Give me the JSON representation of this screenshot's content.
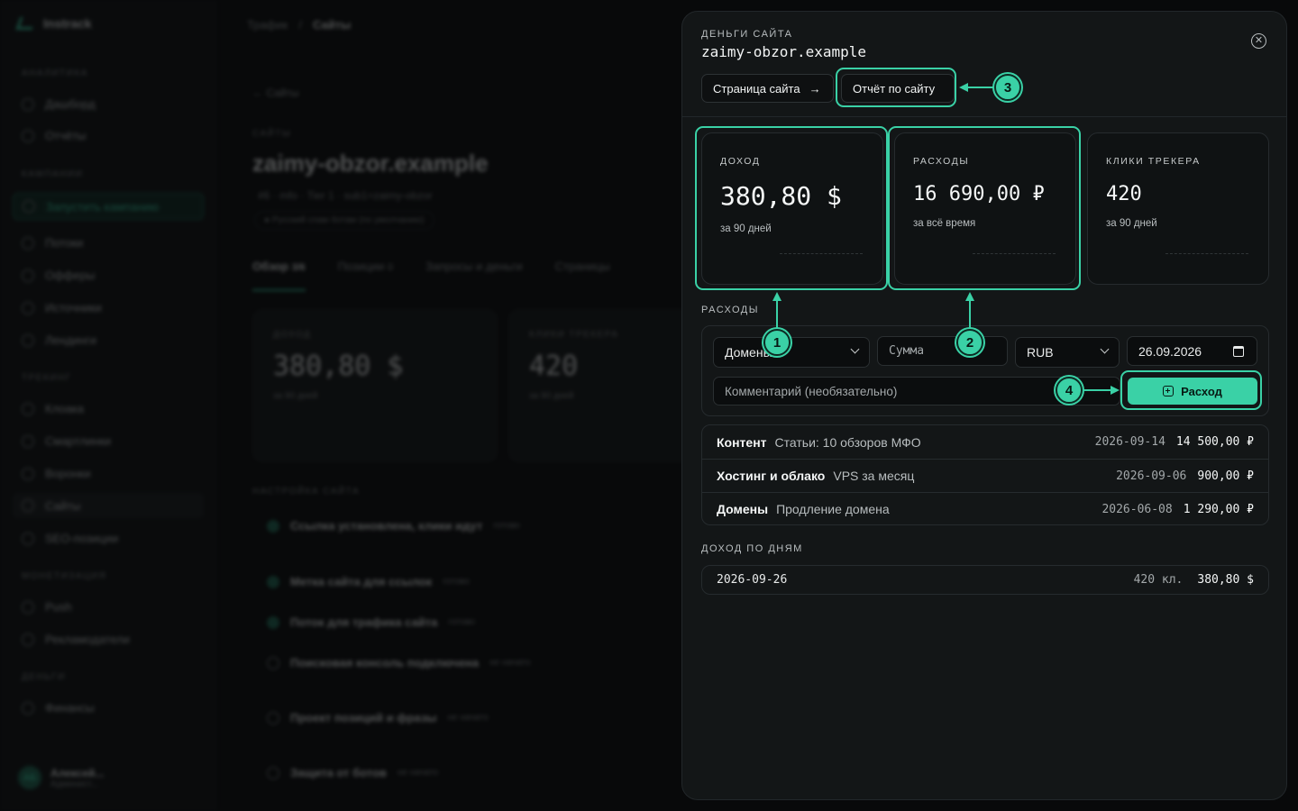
{
  "background": {
    "brand": "Instrack",
    "sidebar": {
      "sections": [
        {
          "label": "АНАЛИТИКА",
          "items": [
            "Дашборд",
            "Отчёты"
          ]
        },
        {
          "label": "КАМПАНИИ",
          "items": [
            "Запустить кампанию",
            "Потоки",
            "Офферы",
            "Источники",
            "Лендинги"
          ]
        },
        {
          "label": "ТРЕКИНГ",
          "items": [
            "Клоака",
            "Смартлинки",
            "Воронки",
            "Сайты",
            "SEO-позиции"
          ]
        },
        {
          "label": "МОНЕТИЗАЦИЯ",
          "items": [
            "Push",
            "Рекламодатели"
          ]
        },
        {
          "label": "ДЕНЬГИ",
          "items": [
            "Финансы"
          ]
        }
      ],
      "user": {
        "initials": "АБ",
        "name": "Алексей...",
        "role": "Админист..."
      }
    },
    "breadcrumbs": [
      "Трафик",
      "Сайты"
    ],
    "back_link": "← Сайты",
    "kicker": "САЙТЫ",
    "title": "zaimy-obzor.example",
    "meta": "#6 · mfo · Tier 1 · sub1=zaimy-obzor",
    "pill": "● Русский спам ботам (по умолчанию)",
    "tabs": [
      "Обзор",
      "Позиции",
      "Запросы и деньги",
      "Страницы"
    ],
    "tab_counts": [
      "3/6",
      "0"
    ],
    "cards": [
      {
        "label": "ДОХОД",
        "value": "380,80 $",
        "sub": "за 90 дней"
      },
      {
        "label": "КЛИКИ ТРЕКЕРА",
        "value": "420",
        "sub": "за 90 дней"
      }
    ],
    "setup_kicker": "НАСТРОЙКА САЙТА",
    "setup_items": [
      {
        "title": "Ссылка установлена, клики идут",
        "status": "готово",
        "done": true
      },
      {
        "title": "Метка сайта для ссылок",
        "status": "готово",
        "done": true
      },
      {
        "title": "Поток для трафика сайта",
        "status": "готово",
        "done": true
      },
      {
        "title": "Поисковая консоль подключена",
        "status": "не начато",
        "done": false
      },
      {
        "title": "Проект позиций и фразы",
        "status": "не начато",
        "done": false
      },
      {
        "title": "Защита от ботов",
        "status": "не начато",
        "done": false
      }
    ]
  },
  "panel": {
    "kicker": "ДЕНЬГИ САЙТА",
    "title": "zaimy-obzor.example",
    "close_icon": "close-circle-icon",
    "buttons": {
      "site_page": "Страница сайта",
      "site_page_icon": "arrow-right-icon",
      "site_report": "Отчёт по сайту"
    },
    "stats": [
      {
        "label": "ДОХОД",
        "value": "380,80 $",
        "sub": "за 90 дней"
      },
      {
        "label": "РАСХОДЫ",
        "value": "16 690,00 ₽",
        "sub": "за всё время"
      },
      {
        "label": "КЛИКИ ТРЕКЕРА",
        "value": "420",
        "sub": "за 90 дней"
      }
    ],
    "expenses": {
      "section_label": "РАСХОДЫ",
      "category_value": "Домены",
      "amount_placeholder": "Сумма",
      "currency_value": "RUB",
      "date_value": "26.09.2026",
      "comment_placeholder": "Комментарий (необязательно)",
      "add_button": "Расход",
      "rows": [
        {
          "category": "Контент",
          "description": "Статьи: 10 обзоров МФО",
          "date": "2026-09-14",
          "amount": "14 500,00 ₽"
        },
        {
          "category": "Хостинг и облако",
          "description": "VPS за месяц",
          "date": "2026-09-06",
          "amount": "900,00 ₽"
        },
        {
          "category": "Домены",
          "description": "Продление домена",
          "date": "2026-06-08",
          "amount": "1 290,00 ₽"
        }
      ]
    },
    "income_by_day": {
      "section_label": "ДОХОД ПО ДНЯМ",
      "rows": [
        {
          "date": "2026-09-26",
          "clicks": "420 кл.",
          "amount": "380,80 $"
        }
      ]
    }
  },
  "annotations": {
    "badges": [
      "1",
      "2",
      "3",
      "4"
    ],
    "accent": "#3ad1a6"
  }
}
